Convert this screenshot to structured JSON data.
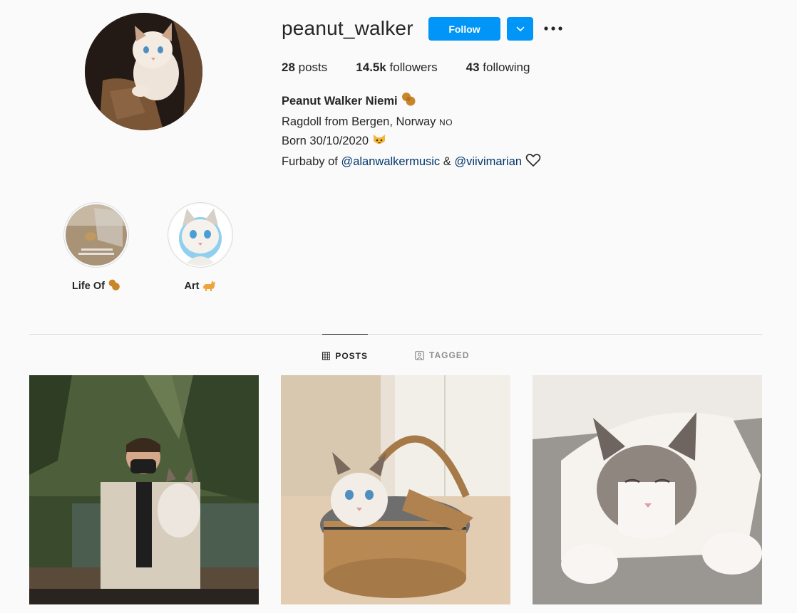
{
  "profile": {
    "username": "peanut_walker",
    "follow_label": "Follow",
    "stats": {
      "posts_count": "28",
      "posts_label": " posts",
      "followers_count": "14.5k",
      "followers_label": " followers",
      "following_count": "43",
      "following_label": " following"
    },
    "bio": {
      "full_name": "Peanut Walker Niemi",
      "line1": "Ragdoll from Bergen, Norway",
      "line1_flag": "NO",
      "line2": "Born 30/10/2020",
      "line3_prefix": "Furbaby of ",
      "mention1": "@alanwalkermusic",
      "line3_amp": " & ",
      "mention2": "@viivimarian"
    }
  },
  "highlights": [
    {
      "label": "Life Of",
      "icon": "peanut-emoji-icon"
    },
    {
      "label": "Art",
      "icon": "cat-emoji-icon"
    }
  ],
  "tabs": [
    {
      "label": "POSTS",
      "icon": "grid-icon",
      "active": true
    },
    {
      "label": "TAGGED",
      "icon": "tagged-user-icon",
      "active": false
    }
  ],
  "colors": {
    "accent": "#0095f6",
    "link": "#00376b",
    "background": "#fafafa",
    "divider": "#dbdbdb"
  }
}
